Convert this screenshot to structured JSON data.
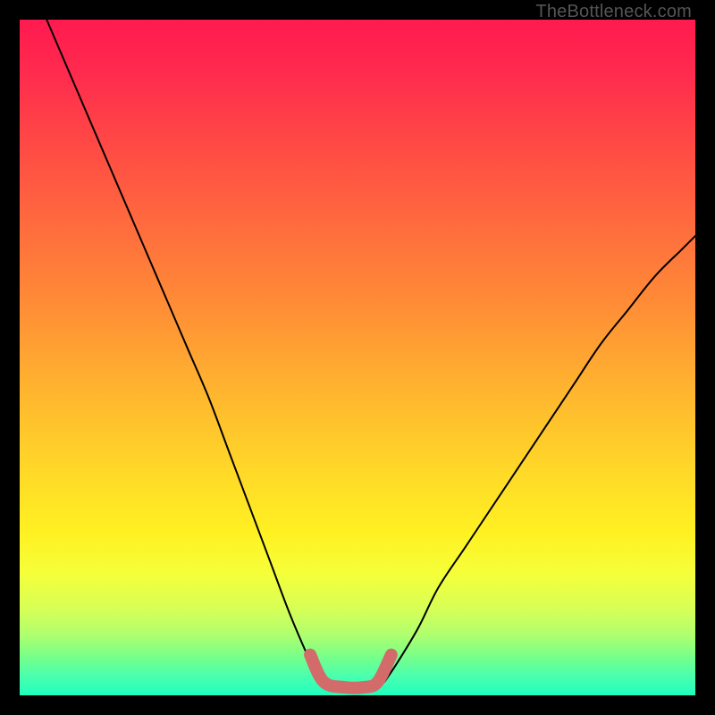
{
  "watermark": "TheBottleneck.com",
  "chart_data": {
    "type": "line",
    "title": "",
    "xlabel": "",
    "ylabel": "",
    "xlim": [
      0,
      100
    ],
    "ylim": [
      0,
      100
    ],
    "grid": false,
    "legend": false,
    "gradient_stops": [
      {
        "pos": 0,
        "color": "#ff1a4f"
      },
      {
        "pos": 18,
        "color": "#ff4845"
      },
      {
        "pos": 42,
        "color": "#ff8c36"
      },
      {
        "pos": 67,
        "color": "#ffd928"
      },
      {
        "pos": 82,
        "color": "#f5ff3a"
      },
      {
        "pos": 94,
        "color": "#7cff86"
      },
      {
        "pos": 100,
        "color": "#1fffbf"
      }
    ],
    "series": [
      {
        "name": "left-branch",
        "x": [
          4,
          7,
          10,
          13,
          16,
          19,
          22,
          25,
          28,
          31,
          34,
          37,
          40,
          43,
          44.5
        ],
        "values": [
          100,
          93,
          86,
          79,
          72,
          65,
          58,
          51,
          44,
          36,
          28,
          20,
          12,
          5,
          2
        ]
      },
      {
        "name": "right-branch",
        "x": [
          54,
          56,
          59,
          62,
          66,
          70,
          74,
          78,
          82,
          86,
          90,
          94,
          98,
          100
        ],
        "values": [
          2,
          5,
          10,
          16,
          22,
          28,
          34,
          40,
          46,
          52,
          57,
          62,
          66,
          68
        ]
      },
      {
        "name": "bottom-marker",
        "x": [
          43,
          45,
          48,
          51,
          53,
          55
        ],
        "values": [
          6,
          2,
          1.2,
          1.2,
          2,
          6
        ]
      }
    ],
    "annotations": []
  }
}
